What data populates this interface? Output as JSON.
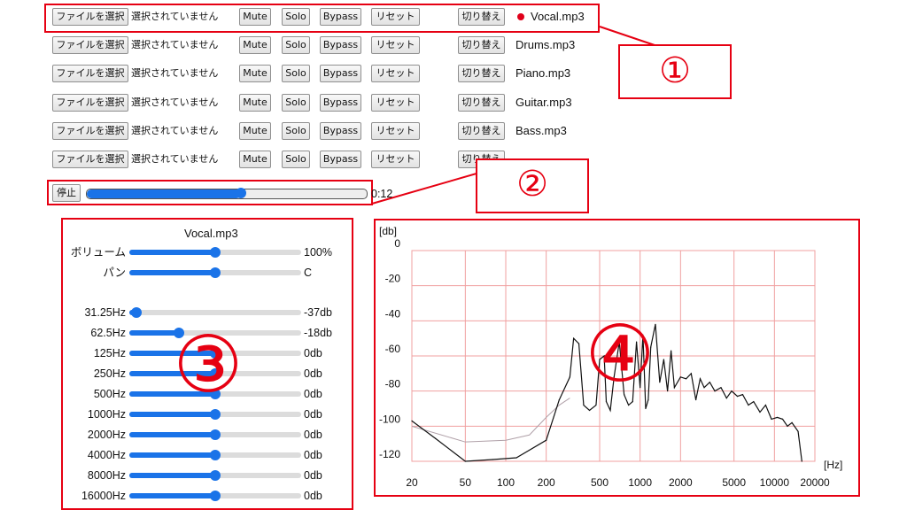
{
  "tracks": [
    {
      "choose_label": "ファイルを選択",
      "nofile": "選択されていません",
      "mute": "Mute",
      "solo": "Solo",
      "bypass": "Bypass",
      "reset": "リセット",
      "switch": "切り替え",
      "filename": "Vocal.mp3",
      "selected": true
    },
    {
      "choose_label": "ファイルを選択",
      "nofile": "選択されていません",
      "mute": "Mute",
      "solo": "Solo",
      "bypass": "Bypass",
      "reset": "リセット",
      "switch": "切り替え",
      "filename": "Drums.mp3",
      "selected": false
    },
    {
      "choose_label": "ファイルを選択",
      "nofile": "選択されていません",
      "mute": "Mute",
      "solo": "Solo",
      "bypass": "Bypass",
      "reset": "リセット",
      "switch": "切り替え",
      "filename": "Piano.mp3",
      "selected": false
    },
    {
      "choose_label": "ファイルを選択",
      "nofile": "選択されていません",
      "mute": "Mute",
      "solo": "Solo",
      "bypass": "Bypass",
      "reset": "リセット",
      "switch": "切り替え",
      "filename": "Guitar.mp3",
      "selected": false
    },
    {
      "choose_label": "ファイルを選択",
      "nofile": "選択されていません",
      "mute": "Mute",
      "solo": "Solo",
      "bypass": "Bypass",
      "reset": "リセット",
      "switch": "切り替え",
      "filename": "Bass.mp3",
      "selected": false
    },
    {
      "choose_label": "ファイルを選択",
      "nofile": "選択されていません",
      "mute": "Mute",
      "solo": "Solo",
      "bypass": "Bypass",
      "reset": "リセット",
      "switch": "切り替え",
      "filename": "",
      "selected": false
    }
  ],
  "transport": {
    "stop_label": "停止",
    "time": "0:12",
    "progress": 0.55
  },
  "callouts": {
    "c1": "①",
    "c2": "②",
    "c3": "③",
    "c4": "④"
  },
  "mixer": {
    "title": "Vocal.mp3",
    "volume": {
      "label": "ボリューム",
      "value_text": "100%",
      "level": 0.5
    },
    "pan": {
      "label": "パン",
      "value_text": "C",
      "level": 0.5
    },
    "eq": [
      {
        "label": "31.25Hz",
        "value_text": "-37db",
        "level": 0.04
      },
      {
        "label": "62.5Hz",
        "value_text": "-18db",
        "level": 0.29
      },
      {
        "label": "125Hz",
        "value_text": "0db",
        "level": 0.5
      },
      {
        "label": "250Hz",
        "value_text": "0db",
        "level": 0.5
      },
      {
        "label": "500Hz",
        "value_text": "0db",
        "level": 0.5
      },
      {
        "label": "1000Hz",
        "value_text": "0db",
        "level": 0.5
      },
      {
        "label": "2000Hz",
        "value_text": "0db",
        "level": 0.5
      },
      {
        "label": "4000Hz",
        "value_text": "0db",
        "level": 0.5
      },
      {
        "label": "8000Hz",
        "value_text": "0db",
        "level": 0.5
      },
      {
        "label": "16000Hz",
        "value_text": "0db",
        "level": 0.5
      }
    ]
  },
  "colors": {
    "accent": "#1a73e8",
    "callout": "#e60012",
    "grid": "#f0a0a0",
    "spectrum": "#111111",
    "spectrum_ghost": "#b0a0a8"
  },
  "chart_data": {
    "type": "line",
    "xlabel": "[Hz]",
    "ylabel": "[db]",
    "xscale": "log",
    "xlim": [
      20,
      20000
    ],
    "ylim": [
      -120,
      0
    ],
    "xticks": [
      "20",
      "50",
      "100",
      "200",
      "500",
      "1000",
      "2000",
      "5000",
      "10000",
      "20000"
    ],
    "yticks": [
      "0",
      "-20",
      "-40",
      "-60",
      "-80",
      "-100",
      "-120"
    ],
    "grid": true,
    "series": [
      {
        "x": [
          20,
          30,
          50,
          80,
          120,
          200,
          250,
          300,
          320,
          350,
          380,
          420,
          470,
          500,
          540,
          560,
          600,
          640,
          700,
          760,
          820,
          880,
          940,
          1000,
          1050,
          1100,
          1150,
          1200,
          1300,
          1400,
          1500,
          1600,
          1700,
          1800,
          2000,
          2200,
          2400,
          2600,
          2800,
          3000,
          3300,
          3600,
          4000,
          4400,
          4800,
          5300,
          5800,
          6400,
          7000,
          7800,
          8600,
          9500,
          10500,
          11500,
          12500,
          13500,
          15000,
          16000
        ],
        "y": [
          -97,
          -107,
          -120,
          -119,
          -118,
          -108,
          -85,
          -72,
          -50,
          -53,
          -88,
          -91,
          -88,
          -62,
          -60,
          -86,
          -91,
          -72,
          -52,
          -82,
          -88,
          -86,
          -52,
          -78,
          -48,
          -90,
          -85,
          -55,
          -42,
          -75,
          -62,
          -80,
          -57,
          -78,
          -72,
          -73,
          -70,
          -85,
          -73,
          -78,
          -75,
          -80,
          -78,
          -84,
          -80,
          -83,
          -82,
          -88,
          -86,
          -92,
          -88,
          -96,
          -95,
          -96,
          -100,
          -98,
          -103,
          -120
        ]
      },
      {
        "x": [
          20,
          50,
          100,
          150,
          200,
          250,
          300
        ],
        "y": [
          -100,
          -109,
          -108,
          -105,
          -95,
          -88,
          -84
        ]
      }
    ]
  }
}
